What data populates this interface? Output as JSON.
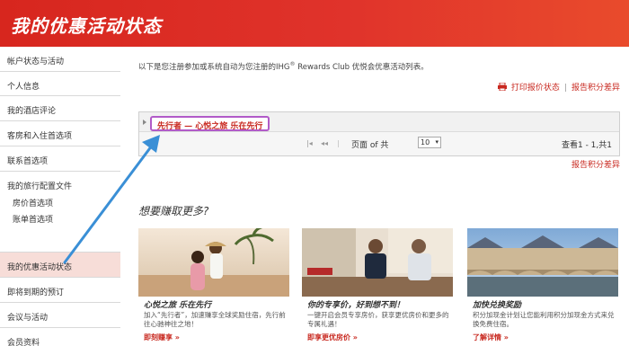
{
  "header": {
    "title": "我的优惠活动状态"
  },
  "sidebar": {
    "items": [
      {
        "label": "帐户状态与活动"
      },
      {
        "label": "个人信息"
      },
      {
        "label": "我的酒店评论"
      },
      {
        "label": "客房和入住首选项"
      },
      {
        "label": "联系首选项"
      },
      {
        "label": "我的旅行配置文件"
      },
      {
        "label": "我的优惠活动状态"
      },
      {
        "label": "即将到期的预订"
      },
      {
        "label": "会议与活动"
      },
      {
        "label": "会员资料"
      }
    ],
    "sub_items": [
      {
        "label": "房价首选项"
      },
      {
        "label": "账单首选项"
      }
    ]
  },
  "main": {
    "intro": "以下是您注册参加或系统自动为您注册的IHG",
    "intro_sup": "®",
    "intro_rest": " Rewards Club 优悦会优惠活动列表。",
    "print_link": "打印报价状态",
    "separator": "|",
    "report_link": "报告积分差异",
    "promo_tag": "先行者 — 心悦之旅 乐在先行",
    "pager_text": "页面 of 共",
    "pager_select": "10",
    "pager_count": "查看1 - 1,共1",
    "report_link_2": "报告积分差异",
    "more_title": "想要赚取更多?"
  },
  "cards": [
    {
      "title": "心悦之旅 乐在先行",
      "desc": "加入“先行者”，加速赚享全球奖励住宿，先行前往心驰神往之地！",
      "link": "即刻赚享 »"
    },
    {
      "title": "你的专享价，好到想不到！",
      "desc": "一键开启会员专享房价，获享更优房价和更多的专属礼遇！",
      "link": "即享更优房价 »"
    },
    {
      "title": "加快兑换奖励",
      "desc": "积分加现金计划让您能利用积分加现金方式来兑换免费住宿。",
      "link": "了解详情 »"
    }
  ],
  "colors": {
    "brand_red": "#d7261e",
    "link_red": "#c8281f",
    "highlight_purple": "#b15bc8",
    "arrow_blue": "#3a8fd6",
    "active_bg": "#f7ddd8"
  }
}
